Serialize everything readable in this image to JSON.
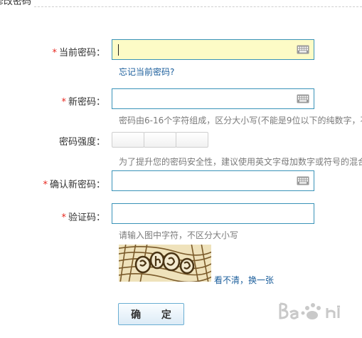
{
  "header": {
    "title": "修改密码"
  },
  "form": {
    "required_mark": "*",
    "current_password": {
      "label": "当前密码：",
      "value": ""
    },
    "forgot_link": "忘记当前密码?",
    "new_password": {
      "label": "新密码：",
      "value": "",
      "hint": "密码由6-16个字符组成，区分大小写(不能是9位以下的纯数字，不"
    },
    "strength": {
      "label": "密码强度：",
      "hint": "为了提升您的密码安全性，建议使用英文字母加数字或符号的混合"
    },
    "confirm_password": {
      "label": "确认新密码：",
      "value": ""
    },
    "captcha": {
      "label": "验证码：",
      "value": "",
      "hint": "请输入图中字符，不区分大小写",
      "refresh_link": "看不清，换一张"
    },
    "submit_label": "确 定"
  },
  "icons": {
    "keyboard": "keyboard-icon"
  },
  "colors": {
    "field_border": "#3a93b8",
    "focused_bg": "#fdfbc6",
    "required": "#e8281f",
    "link": "#1a5d9b",
    "hint": "#7a7a7a"
  }
}
